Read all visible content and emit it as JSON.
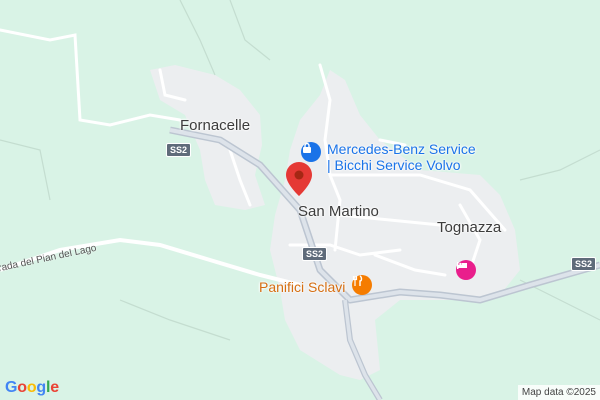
{
  "map": {
    "places": {
      "fornacelle": "Fornacelle",
      "san_martino": "San Martino",
      "tognazza": "Tognazza"
    },
    "pois": {
      "mercedes_line1": "Mercedes-Benz Service",
      "mercedes_line2": "| Bicchi Service Volvo",
      "panifici": "Panifici Sclavi"
    },
    "roads": {
      "strada_pian": "Strada del Pian del Lago",
      "ss2": "SS2"
    },
    "attribution": "Map data ©2025",
    "logo": "Google",
    "colors": {
      "land": "#d9f3e6",
      "urban": "#eceef0",
      "road": "#ffffff",
      "highway": "#bcc5d1",
      "pin": "#e53935",
      "poi_blue": "#1a73e8",
      "poi_orange": "#f57c00",
      "poi_pink": "#e91e8c"
    }
  }
}
